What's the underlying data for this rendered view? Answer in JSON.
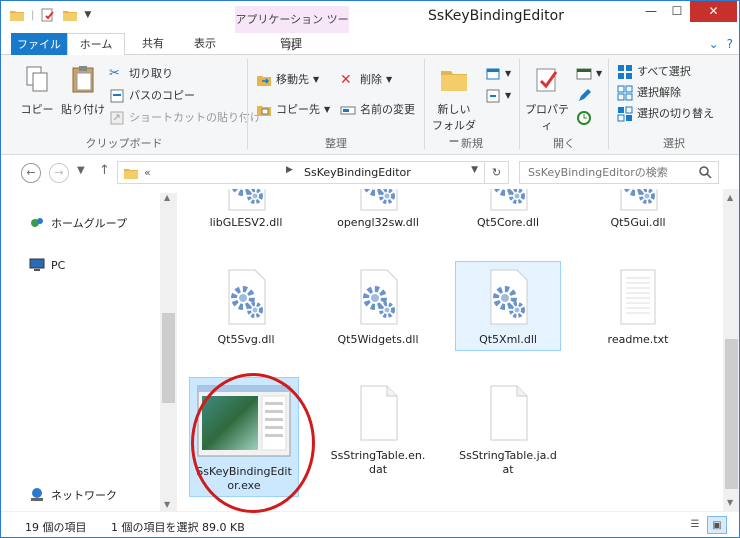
{
  "window": {
    "title": "SsKeyBindingEditor",
    "contextual_tab": "アプリケーション ツール",
    "controls": {
      "minimize": "—",
      "maximize": "☐",
      "close": "✕"
    }
  },
  "ribbon_tabs": {
    "file": "ファイル",
    "home": "ホーム",
    "share": "共有",
    "view": "表示",
    "manage": "管理"
  },
  "ribbon": {
    "clipboard": {
      "label": "クリップボード",
      "copy": "コピー",
      "paste": "貼り付け",
      "cut": "切り取り",
      "copy_path": "パスのコピー",
      "paste_shortcut": "ショートカットの貼り付け"
    },
    "organize": {
      "label": "整理",
      "move_to": "移動先",
      "copy_to": "コピー先",
      "delete": "削除",
      "rename": "名前の変更"
    },
    "new": {
      "label": "新規",
      "new_folder_l1": "新しい",
      "new_folder_l2": "フォルダー"
    },
    "open": {
      "label": "開く",
      "properties": "プロパティ"
    },
    "select": {
      "label": "選択",
      "select_all": "すべて選択",
      "select_none": "選択解除",
      "invert": "選択の切り替え"
    }
  },
  "address": {
    "chevron": "«",
    "path": "SsKeyBindingEditor",
    "search_placeholder": "SsKeyBindingEditorの検索"
  },
  "nav_pane": {
    "homegroup": "ホームグループ",
    "pc": "PC",
    "network": "ネットワーク"
  },
  "files": [
    {
      "name": "libGLESV2.dll",
      "type": "dll"
    },
    {
      "name": "opengl32sw.dll",
      "type": "dll"
    },
    {
      "name": "Qt5Core.dll",
      "type": "dll"
    },
    {
      "name": "Qt5Gui.dll",
      "type": "dll"
    },
    {
      "name": "Qt5Svg.dll",
      "type": "dll"
    },
    {
      "name": "Qt5Widgets.dll",
      "type": "dll"
    },
    {
      "name": "Qt5Xml.dll",
      "type": "dll"
    },
    {
      "name": "readme.txt",
      "type": "txt"
    },
    {
      "name": "SsKeyBindingEditor.exe",
      "type": "exe"
    },
    {
      "name": "SsStringTable.en.dat",
      "type": "dat"
    },
    {
      "name": "SsStringTable.ja.dat",
      "type": "dat"
    }
  ],
  "status": {
    "item_count": "19 個の項目",
    "selection": "1 個の項目を選択  89.0 KB"
  },
  "colors": {
    "accent": "#1979ca",
    "selection": "#cce8ff",
    "annotation": "#d11a1a"
  }
}
